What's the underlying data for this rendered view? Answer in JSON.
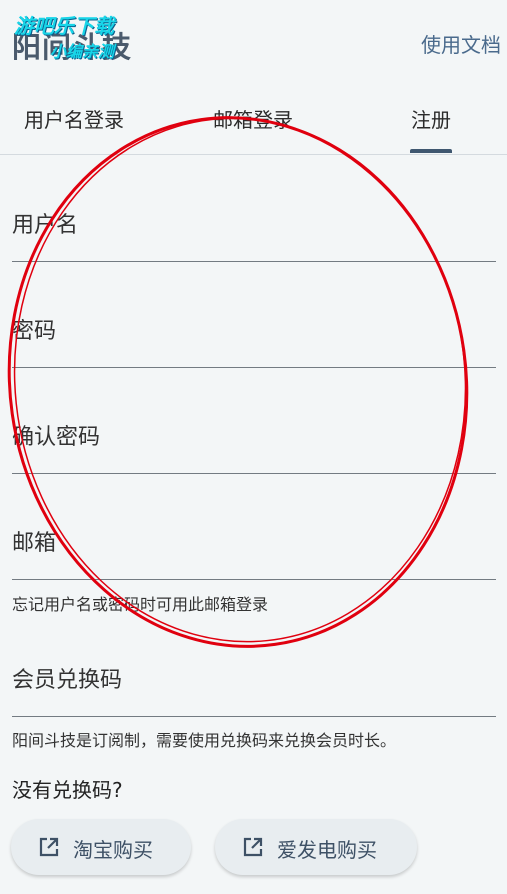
{
  "header": {
    "title": "阳间斗技",
    "docs_link": "使用文档",
    "watermark_line1": "游吧乐下载",
    "watermark_line2": "小编亲测"
  },
  "tabs": [
    {
      "label": "用户名登录",
      "selected": false
    },
    {
      "label": "邮箱登录",
      "selected": false
    },
    {
      "label": "注册",
      "selected": true
    }
  ],
  "form": {
    "username_label": "用户名",
    "password_label": "密码",
    "confirm_password_label": "确认密码",
    "email_label": "邮箱",
    "email_helper": "忘记用户名或密码时可用此邮箱登录",
    "redeem_code_label": "会员兑换码",
    "redeem_helper": "阳间斗技是订阅制，需要使用兑换码来兑换会员时长。"
  },
  "no_code_text": "没有兑换码?",
  "buttons": {
    "taobao": "淘宝购买",
    "afdian": "爱发电购买"
  },
  "icons": {
    "buy": "open-in-new-icon"
  },
  "colors": {
    "background": "#f3f6f7",
    "accent": "#3f5770",
    "annotation": "#e0000f",
    "watermark": "#18d5e8"
  }
}
